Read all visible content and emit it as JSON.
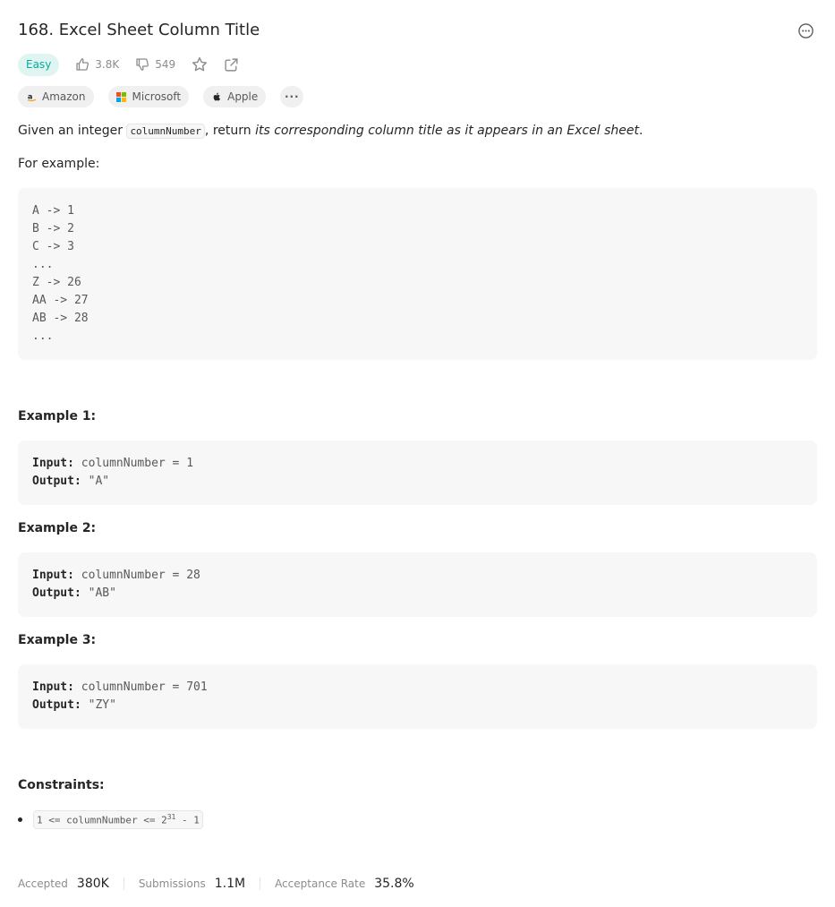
{
  "problem": {
    "title": "168. Excel Sheet Column Title",
    "difficulty": "Easy",
    "likes": "3.8K",
    "dislikes": "549"
  },
  "companies": [
    {
      "name": "Amazon"
    },
    {
      "name": "Microsoft"
    },
    {
      "name": "Apple"
    }
  ],
  "more_tags": "···",
  "description": {
    "prefix": "Given an integer ",
    "code": "columnNumber",
    "middle": ", return ",
    "emphasis": "its corresponding column title as it appears in an Excel sheet",
    "suffix": ".",
    "for_example": "For example:"
  },
  "example_mapping": [
    "A -> 1",
    "B -> 2",
    "C -> 3",
    "...",
    "Z -> 26",
    "AA -> 27",
    "AB -> 28",
    "..."
  ],
  "examples": [
    {
      "heading": "Example 1:",
      "input_label": "Input:",
      "input": "columnNumber = 1",
      "output_label": "Output:",
      "output": "\"A\""
    },
    {
      "heading": "Example 2:",
      "input_label": "Input:",
      "input": "columnNumber = 28",
      "output_label": "Output:",
      "output": "\"AB\""
    },
    {
      "heading": "Example 3:",
      "input_label": "Input:",
      "input": "columnNumber = 701",
      "output_label": "Output:",
      "output": "\"ZY\""
    }
  ],
  "constraints": {
    "heading": "Constraints:",
    "item_prefix": "1 <= columnNumber <= 2",
    "item_sup": "31",
    "item_suffix": " - 1"
  },
  "stats": {
    "accepted_label": "Accepted",
    "accepted_value": "380K",
    "submissions_label": "Submissions",
    "submissions_value": "1.1M",
    "rate_label": "Acceptance Rate",
    "rate_value": "35.8%"
  },
  "colors": {
    "easy_text": "#00af9b",
    "easy_bg": "#e0f5f1",
    "amazon": "#ff9900",
    "ms_red": "#f25022",
    "ms_green": "#7fba00",
    "ms_blue": "#00a4ef",
    "ms_yellow": "#ffb900"
  },
  "icons": {
    "more": "more-horizontal-circle-icon",
    "like": "thumbs-up-icon",
    "dislike": "thumbs-down-icon",
    "favorite": "star-icon",
    "share": "share-icon"
  }
}
